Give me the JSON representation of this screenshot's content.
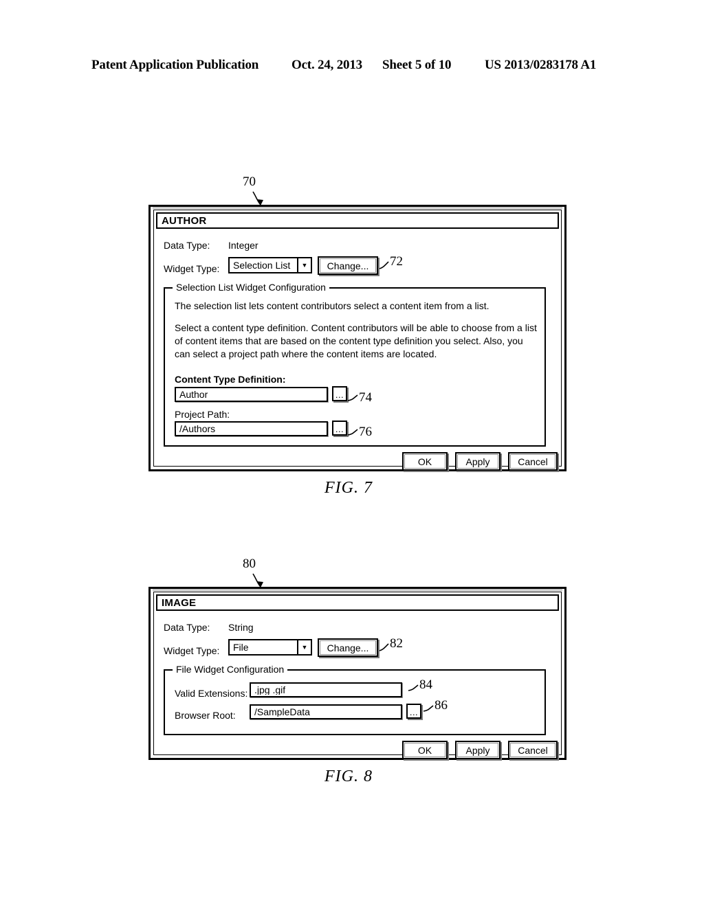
{
  "page_header": {
    "publication": "Patent Application Publication",
    "date": "Oct. 24, 2013",
    "sheet": "Sheet 5 of 10",
    "patent_number": "US 2013/0283178 A1"
  },
  "figure7": {
    "caption": "FIG. 7",
    "callout_dialog": "70",
    "callout_change": "72",
    "callout_content_type": "74",
    "callout_project_path": "76",
    "title": "AUTHOR",
    "data_type_label": "Data Type:",
    "data_type_value": "Integer",
    "widget_type_label": "Widget Type:",
    "widget_type_value": "Selection List",
    "widget_type_arrow": "▼",
    "change_button": "Change...",
    "group_title": "Selection List Widget Configuration",
    "paragraph1": "The selection list lets content contributors select a content item from a list.",
    "paragraph2": "Select a content type definition. Content contributors will be able to choose from a list of content items that are based on the content type definition you select. Also, you can select a project path where the content items are located.",
    "content_type_label": "Content  Type  Definition:",
    "content_type_value": "Author",
    "project_path_label": "Project Path:",
    "project_path_value": "/Authors",
    "browse_label": "...",
    "ok_button": "OK",
    "apply_button": "Apply",
    "cancel_button": "Cancel"
  },
  "figure8": {
    "caption": "FIG. 8",
    "callout_dialog": "80",
    "callout_change": "82",
    "callout_valid_extensions": "84",
    "callout_browser_root": "86",
    "title": "IMAGE",
    "data_type_label": "Data Type:",
    "data_type_value": "String",
    "widget_type_label": "Widget Type:",
    "widget_type_value": "File",
    "widget_type_arrow": "▼",
    "change_button": "Change...",
    "group_title": "File Widget Configuration",
    "valid_extensions_label": "Valid Extensions:",
    "valid_extensions_value": ".jpg .gif",
    "browser_root_label": "Browser Root:",
    "browser_root_value": "/SampleData",
    "browse_label": "...",
    "ok_button": "OK",
    "apply_button": "Apply",
    "cancel_button": "Cancel"
  }
}
